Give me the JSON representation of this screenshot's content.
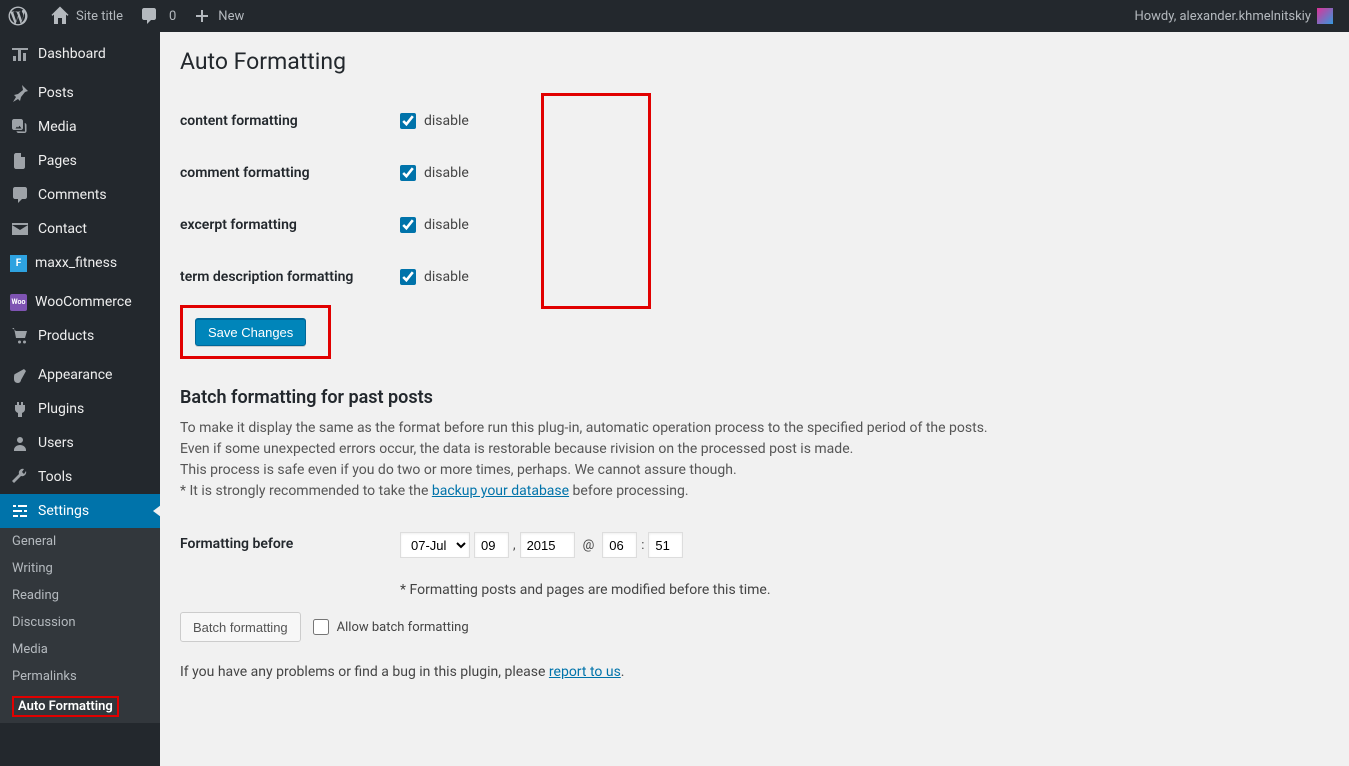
{
  "adminbar": {
    "site_title": "Site title",
    "comments_count": "0",
    "new_label": "New",
    "howdy": "Howdy, alexander.khmelnitskiy"
  },
  "menu": {
    "dashboard": "Dashboard",
    "posts": "Posts",
    "media": "Media",
    "pages": "Pages",
    "comments": "Comments",
    "contact": "Contact",
    "maxx_fitness": "maxx_fitness",
    "woocommerce": "WooCommerce",
    "products": "Products",
    "appearance": "Appearance",
    "plugins": "Plugins",
    "users": "Users",
    "tools": "Tools",
    "settings": "Settings"
  },
  "submenu": {
    "general": "General",
    "writing": "Writing",
    "reading": "Reading",
    "discussion": "Discussion",
    "media": "Media",
    "permalinks": "Permalinks",
    "auto_formatting": "Auto Formatting"
  },
  "page": {
    "title": "Auto Formatting",
    "rows": {
      "content": "content formatting",
      "comment": "comment formatting",
      "excerpt": "excerpt formatting",
      "term": "term description formatting"
    },
    "disable_label": "disable",
    "save_button": "Save Changes",
    "batch_heading": "Batch formatting for past posts",
    "desc_line1": "To make it display the same as the format before run this plug-in, automatic operation process to the specified period of the posts.",
    "desc_line2": "Even if some unexpected errors occur, the data is restorable because rivision on the processed post is made.",
    "desc_line3": "This process is safe even if you do two or more times, perhaps. We cannot assure though.",
    "desc_line4_prefix": "* It is strongly recommended to take the ",
    "desc_line4_link": "backup your database",
    "desc_line4_suffix": " before processing.",
    "formatting_before_label": "Formatting before",
    "month_selected": "07-Jul",
    "day": "09",
    "year": "2015",
    "hour": "06",
    "minute": "51",
    "at_symbol": "@",
    "colon": ":",
    "comma": ",",
    "time_note": "* Formatting posts and pages are modified before this time.",
    "batch_button": "Batch formatting",
    "allow_batch_label": "Allow batch formatting",
    "report_prefix": "If you have any problems or find a bug in this plugin, please ",
    "report_link": "report to us",
    "report_suffix": "."
  }
}
